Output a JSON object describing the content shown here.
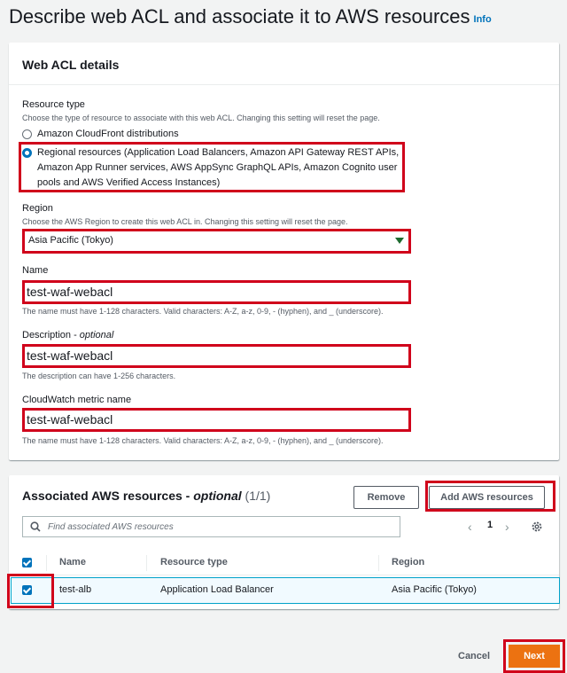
{
  "page": {
    "title": "Describe web ACL and associate it to AWS resources",
    "info_link": "Info"
  },
  "details": {
    "header": "Web ACL details",
    "resource_type": {
      "label": "Resource type",
      "description": "Choose the type of resource to associate with this web ACL. Changing this setting will reset the page.",
      "options": [
        {
          "label": "Amazon CloudFront distributions",
          "selected": false
        },
        {
          "line1": "Regional resources (Application Load Balancers, Amazon API Gateway REST APIs,",
          "line2": "Amazon App Runner services, AWS AppSync GraphQL APIs, Amazon Cognito user",
          "line3": "pools and AWS Verified Access Instances)",
          "selected": true
        }
      ]
    },
    "region": {
      "label": "Region",
      "description": "Choose the AWS Region to create this web ACL in. Changing this setting will reset the page.",
      "value": "Asia Pacific (Tokyo)"
    },
    "name": {
      "label": "Name",
      "value": "test-waf-webacl",
      "hint": "The name must have 1-128 characters. Valid characters: A-Z, a-z, 0-9, - (hyphen), and _ (underscore)."
    },
    "description": {
      "label": "Description - ",
      "optional": "optional",
      "value": "test-waf-webacl",
      "hint": "The description can have 1-256 characters."
    },
    "metric": {
      "label": "CloudWatch metric name",
      "value": "test-waf-webacl",
      "hint": "The name must have 1-128 characters. Valid characters: A-Z, a-z, 0-9, - (hyphen), and _ (underscore)."
    }
  },
  "resources": {
    "title": "Associated AWS resources - ",
    "optional": "optional",
    "count": "(1/1)",
    "remove_label": "Remove",
    "add_label": "Add AWS resources",
    "search_placeholder": "Find associated AWS resources",
    "page": "1",
    "columns": [
      "Name",
      "Resource type",
      "Region"
    ],
    "rows": [
      {
        "name": "test-alb",
        "type": "Application Load Balancer",
        "region": "Asia Pacific (Tokyo)",
        "selected": true
      }
    ]
  },
  "footer": {
    "cancel_label": "Cancel",
    "next_label": "Next"
  },
  "colors": {
    "accent": "#0073bb",
    "highlight": "#d0021b",
    "primary": "#ec7211"
  }
}
